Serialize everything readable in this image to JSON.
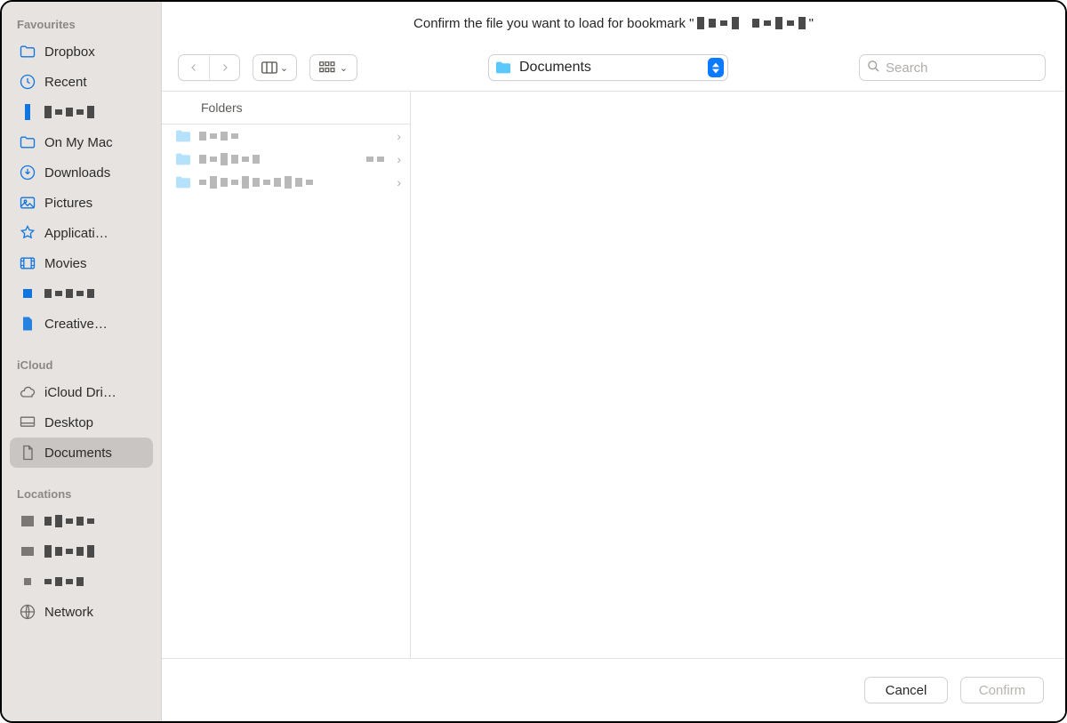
{
  "title_prefix": "Confirm the file you want to load for bookmark \"",
  "title_bookmark_redacted": true,
  "title_suffix": "\"",
  "toolbar": {
    "path_label": "Documents",
    "search_placeholder": "Search"
  },
  "sidebar": {
    "sections": [
      {
        "title": "Favourites",
        "items": [
          {
            "icon": "folder",
            "label": "Dropbox"
          },
          {
            "icon": "clock",
            "label": "Recent"
          },
          {
            "icon": "redacted",
            "label": ""
          },
          {
            "icon": "folder",
            "label": "On My Mac"
          },
          {
            "icon": "download",
            "label": "Downloads"
          },
          {
            "icon": "pictures",
            "label": "Pictures"
          },
          {
            "icon": "apps",
            "label": "Applicati…"
          },
          {
            "icon": "movies",
            "label": "Movies"
          },
          {
            "icon": "redacted",
            "label": ""
          },
          {
            "icon": "doc",
            "label": "Creative…"
          }
        ]
      },
      {
        "title": "iCloud",
        "items": [
          {
            "icon": "cloud",
            "label": "iCloud Dri…"
          },
          {
            "icon": "desktop",
            "label": "Desktop"
          },
          {
            "icon": "doc",
            "label": "Documents",
            "selected": true
          }
        ]
      },
      {
        "title": "Locations",
        "items": [
          {
            "icon": "redacted-grey",
            "label": ""
          },
          {
            "icon": "redacted-grey",
            "label": ""
          },
          {
            "icon": "redacted-grey",
            "label": ""
          },
          {
            "icon": "network",
            "label": "Network"
          }
        ]
      }
    ]
  },
  "column": {
    "header": "Folders",
    "rows": [
      {
        "label_redacted": true,
        "meta_redacted": false
      },
      {
        "label_redacted": true,
        "meta_redacted": true
      },
      {
        "label_redacted": true,
        "meta_redacted": true
      }
    ]
  },
  "footer": {
    "cancel": "Cancel",
    "confirm": "Confirm"
  }
}
